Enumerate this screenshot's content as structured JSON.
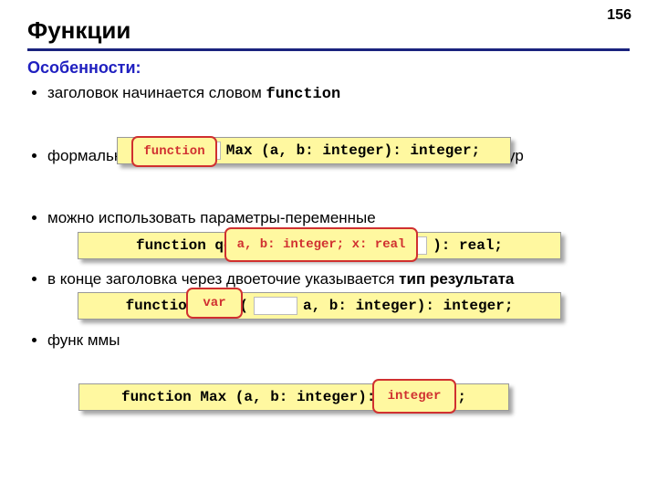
{
  "page_number": "156",
  "title": "Функции",
  "subheading": "Особенности:",
  "bullets": [
    {
      "pre": "заголовок начинается словом ",
      "mono": "function",
      "post": ""
    },
    {
      "pre": "формальные параметры описываются так же, как и для процедур",
      "mono": "",
      "post": ""
    },
    {
      "pre": "можно использовать параметры-переменные",
      "mono": "",
      "post": ""
    },
    {
      "pre": "в конце заголовка через двоеточие указывается ",
      "mono": "",
      "bold": "тип результата"
    },
    {
      "pre": "функ                                                    ммы",
      "mono": "",
      "post": ""
    }
  ],
  "code_lines": {
    "line1": {
      "head": "",
      "mid": "Max (a, b: integer): integer;",
      "highlight": "function"
    },
    "line2": {
      "head": "function qq(",
      "tail": "): real;",
      "highlight": "a, b: integer; x: real"
    },
    "line3": {
      "head": "function Max (",
      "tail": "a, b: integer): integer;",
      "highlight": "var"
    },
    "line4": {
      "head": "function Max (a, b: integer):",
      "tail": ";",
      "highlight": "integer"
    }
  }
}
